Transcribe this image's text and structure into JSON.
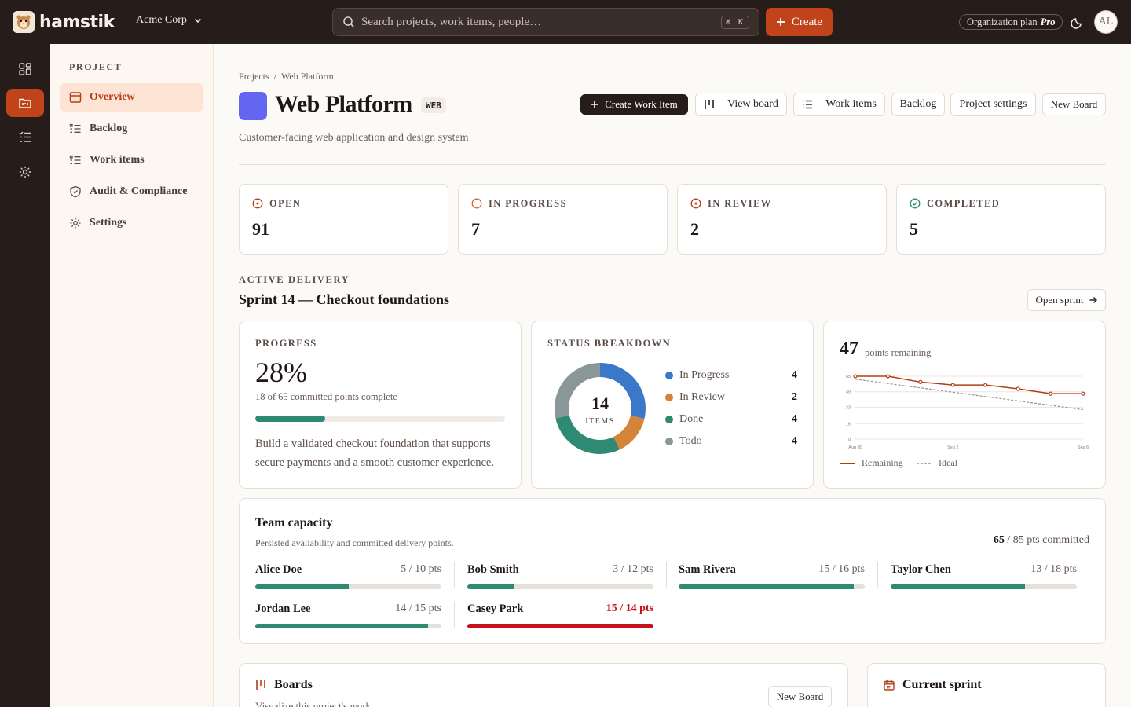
{
  "app": {
    "brand": "hamstik",
    "org": "Acme Corp"
  },
  "topbar": {
    "search_placeholder": "Search projects, work items, people…",
    "search_shortcut": "⌘ K",
    "create_label": "Create",
    "plan_label": "Organization plan",
    "plan_tier": "Pro",
    "avatar_initials": "AL"
  },
  "rail": [
    "dashboard-icon",
    "projects-icon",
    "work-items-icon",
    "settings-icon"
  ],
  "sidebar": {
    "heading": "PROJECT",
    "items": [
      {
        "label": "Overview",
        "icon": "overview-icon",
        "active": true
      },
      {
        "label": "Backlog",
        "icon": "list-icon"
      },
      {
        "label": "Work items",
        "icon": "list-icon"
      },
      {
        "label": "Audit & Compliance",
        "icon": "shield-icon"
      },
      {
        "label": "Settings",
        "icon": "gear-icon"
      }
    ]
  },
  "breadcrumb": [
    "Projects",
    "/",
    "Web Platform"
  ],
  "project": {
    "title": "Web Platform",
    "key": "WEB",
    "description": "Customer-facing web application and design system",
    "color": "#6366f1"
  },
  "actions": {
    "create_work_item": "Create Work Item",
    "view_board": "View board",
    "work_items": "Work items",
    "backlog": "Backlog",
    "project_settings": "Project settings",
    "new_board": "New Board"
  },
  "stats": [
    {
      "label": "OPEN",
      "value": "91"
    },
    {
      "label": "IN PROGRESS",
      "value": "7"
    },
    {
      "label": "IN REVIEW",
      "value": "2"
    },
    {
      "label": "COMPLETED",
      "value": "5"
    }
  ],
  "delivery": {
    "section_label": "ACTIVE DELIVERY",
    "sprint_title": "Sprint 14 — Checkout foundations",
    "open_sprint": "Open sprint"
  },
  "progress": {
    "label": "PROGRESS",
    "percent_text": "28%",
    "percent": 0.28,
    "subtitle": "18 of 65 committed points complete",
    "goal": "Build a validated checkout foundation that supports secure payments and a smooth customer experience."
  },
  "status_breakdown": {
    "label": "STATUS BREAKDOWN",
    "total": "14",
    "total_label": "ITEMS",
    "items": [
      {
        "label": "In Progress",
        "count": "4",
        "value": 4,
        "color": "#3b78c9"
      },
      {
        "label": "In Review",
        "count": "2",
        "value": 2,
        "color": "#d38438"
      },
      {
        "label": "Done",
        "count": "4",
        "value": 4,
        "color": "#2f8a73"
      },
      {
        "label": "Todo",
        "count": "4",
        "value": 4,
        "color": "#8a9799"
      }
    ]
  },
  "burndown": {
    "remaining": "47",
    "remaining_label": "points remaining",
    "legend_remaining": "Remaining",
    "legend_ideal": "Ideal"
  },
  "chart_data": {
    "type": "line",
    "x": [
      "Aug 30",
      "Aug 31",
      "Sep 1",
      "Sep 2",
      "Sep 3",
      "Sep 4",
      "Sep 5",
      "Sep 6"
    ],
    "xticks": [
      "Aug 30",
      "Sep 2",
      "Sep 6"
    ],
    "yticks": [
      "0",
      "16",
      "33",
      "49",
      "65"
    ],
    "ylim": [
      0,
      65
    ],
    "series": [
      {
        "name": "Remaining",
        "values": [
          65,
          65,
          59,
          56,
          56,
          52,
          47,
          47
        ],
        "color": "#b23e16"
      },
      {
        "name": "Ideal",
        "values": [
          62,
          57.5,
          53,
          48.5,
          44,
          39.5,
          35,
          30.5
        ],
        "color": "#9a918c"
      }
    ],
    "legend": "bottom-left",
    "grid": true
  },
  "capacity": {
    "title": "Team capacity",
    "subtitle": "Persisted availability and committed delivery points.",
    "committed": "65",
    "committed_rest": "/ 85 pts committed",
    "members": [
      {
        "name": "Alice Doe",
        "pts": "5 / 10 pts",
        "ratio": 0.5
      },
      {
        "name": "Bob Smith",
        "pts": "3 / 12 pts",
        "ratio": 0.25
      },
      {
        "name": "Sam Rivera",
        "pts": "15 / 16 pts",
        "ratio": 0.94
      },
      {
        "name": "Taylor Chen",
        "pts": "13 / 18 pts",
        "ratio": 0.72
      },
      {
        "name": "Jordan Lee",
        "pts": "14 / 15 pts",
        "ratio": 0.93
      },
      {
        "name": "Casey Park",
        "pts": "15 / 14 pts",
        "ratio": 1.0,
        "over": true
      }
    ]
  },
  "boards": {
    "title": "Boards",
    "subtitle": "Visualize this project's work.",
    "new_board": "New Board"
  },
  "current_sprint": {
    "title": "Current sprint"
  }
}
